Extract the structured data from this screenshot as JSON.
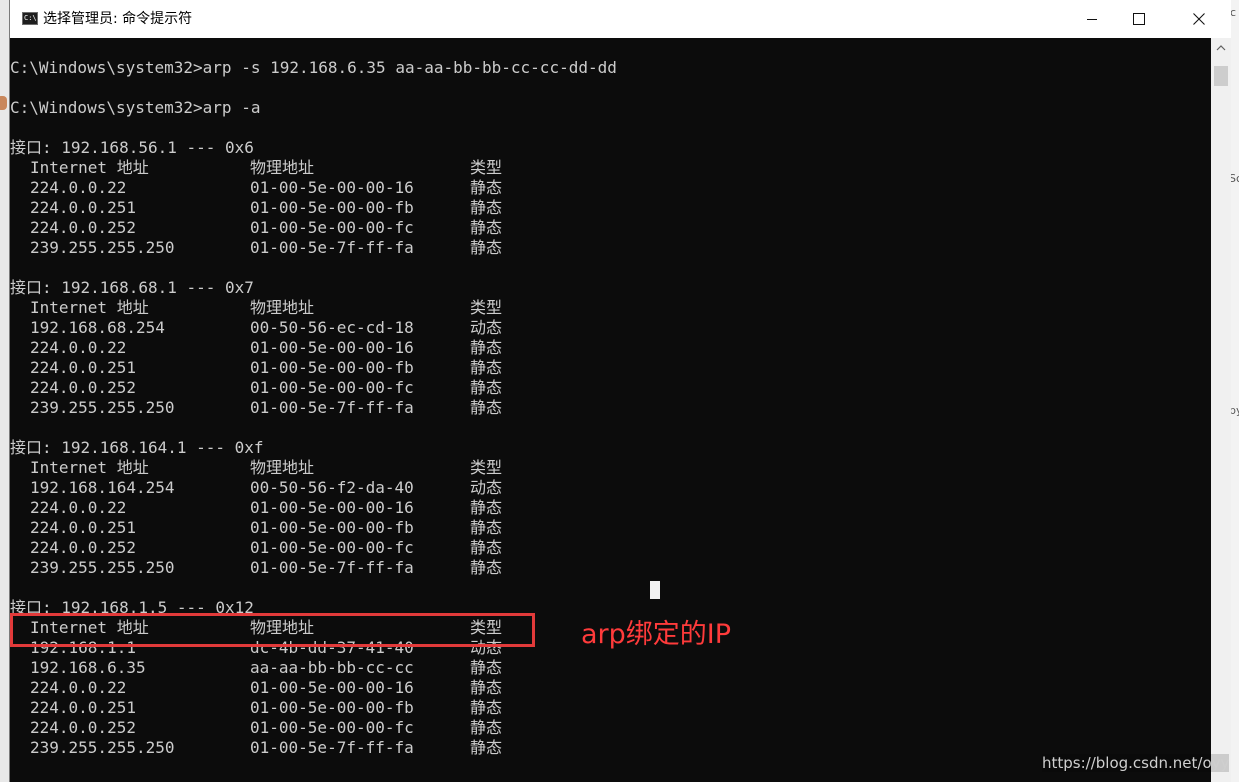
{
  "window": {
    "title": "选择管理员: 命令提示符",
    "icon_label": "C:\\"
  },
  "console": {
    "commands": [
      "C:\\Windows\\system32>arp -s 192.168.6.35 aa-aa-bb-bb-cc-cc-dd-dd",
      "C:\\Windows\\system32>arp -a"
    ],
    "header": {
      "ip": "Internet 地址",
      "mac": "物理地址",
      "type": "类型"
    },
    "interfaces": [
      {
        "label": "接口: 192.168.56.1 --- 0x6",
        "entries": [
          {
            "ip": "224.0.0.22",
            "mac": "01-00-5e-00-00-16",
            "type": "静态"
          },
          {
            "ip": "224.0.0.251",
            "mac": "01-00-5e-00-00-fb",
            "type": "静态"
          },
          {
            "ip": "224.0.0.252",
            "mac": "01-00-5e-00-00-fc",
            "type": "静态"
          },
          {
            "ip": "239.255.255.250",
            "mac": "01-00-5e-7f-ff-fa",
            "type": "静态"
          }
        ]
      },
      {
        "label": "接口: 192.168.68.1 --- 0x7",
        "entries": [
          {
            "ip": "192.168.68.254",
            "mac": "00-50-56-ec-cd-18",
            "type": "动态"
          },
          {
            "ip": "224.0.0.22",
            "mac": "01-00-5e-00-00-16",
            "type": "静态"
          },
          {
            "ip": "224.0.0.251",
            "mac": "01-00-5e-00-00-fb",
            "type": "静态"
          },
          {
            "ip": "224.0.0.252",
            "mac": "01-00-5e-00-00-fc",
            "type": "静态"
          },
          {
            "ip": "239.255.255.250",
            "mac": "01-00-5e-7f-ff-fa",
            "type": "静态"
          }
        ]
      },
      {
        "label": "接口: 192.168.164.1 --- 0xf",
        "entries": [
          {
            "ip": "192.168.164.254",
            "mac": "00-50-56-f2-da-40",
            "type": "动态"
          },
          {
            "ip": "224.0.0.22",
            "mac": "01-00-5e-00-00-16",
            "type": "静态"
          },
          {
            "ip": "224.0.0.251",
            "mac": "01-00-5e-00-00-fb",
            "type": "静态"
          },
          {
            "ip": "224.0.0.252",
            "mac": "01-00-5e-00-00-fc",
            "type": "静态"
          },
          {
            "ip": "239.255.255.250",
            "mac": "01-00-5e-7f-ff-fa",
            "type": "静态"
          }
        ]
      },
      {
        "label": "接口: 192.168.1.5 --- 0x12",
        "entries": [
          {
            "ip": "192.168.1.1",
            "mac": "dc-4b-dd-37-41-40",
            "type": "动态"
          },
          {
            "ip": "192.168.6.35",
            "mac": "aa-aa-bb-bb-cc-cc",
            "type": "静态"
          },
          {
            "ip": "224.0.0.22",
            "mac": "01-00-5e-00-00-16",
            "type": "静态"
          },
          {
            "ip": "224.0.0.251",
            "mac": "01-00-5e-00-00-fb",
            "type": "静态"
          },
          {
            "ip": "224.0.0.252",
            "mac": "01-00-5e-00-00-fc",
            "type": "静态"
          },
          {
            "ip": "239.255.255.250",
            "mac": "01-00-5e-7f-ff-fa",
            "type": "静态"
          }
        ]
      }
    ]
  },
  "annotation": {
    "text": "arp绑定的IP",
    "color": "#ff3b3b"
  },
  "watermark": "https://blog.csdn.net/oyy",
  "icons": {
    "minimize": "minimize-icon",
    "maximize": "maximize-icon",
    "close": "close-icon",
    "scroll_up": "chevron-up-icon"
  }
}
